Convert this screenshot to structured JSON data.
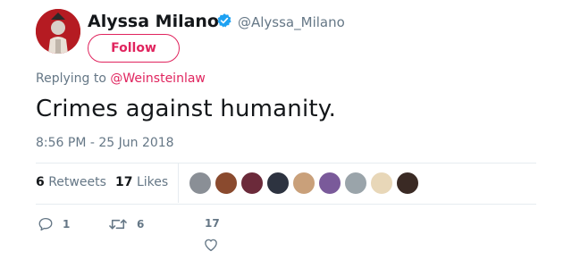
{
  "author": {
    "display_name": "Alyssa Milano",
    "handle": "@Alyssa_Milano",
    "verified": true,
    "follow_label": "Follow"
  },
  "reply_context": {
    "prefix": "Replying to ",
    "mention": "@Weinsteinlaw"
  },
  "tweet": {
    "text": "Crimes against humanity.",
    "timestamp": "8:56 PM - 25 Jun 2018"
  },
  "stats": {
    "retweets_count": "6",
    "retweets_label": "Retweets",
    "likes_count": "17",
    "likes_label": "Likes",
    "likers": [
      {
        "name": "liker-1",
        "color": "#8a8f96"
      },
      {
        "name": "liker-2",
        "color": "#8a4a2e"
      },
      {
        "name": "liker-3",
        "color": "#6b2a3a"
      },
      {
        "name": "liker-4",
        "color": "#2d3340"
      },
      {
        "name": "liker-5",
        "color": "#c9a07a"
      },
      {
        "name": "liker-6",
        "color": "#7a5a9a"
      },
      {
        "name": "liker-7",
        "color": "#9aa4aa"
      },
      {
        "name": "liker-8",
        "color": "#e8d7b8"
      },
      {
        "name": "liker-9",
        "color": "#3a2a24"
      }
    ]
  },
  "actions": {
    "reply_count": "1",
    "retweet_count": "6",
    "like_count": "17"
  },
  "colors": {
    "accent": "#e0245e",
    "verified": "#1da1f2",
    "secondary_text": "#657786"
  }
}
